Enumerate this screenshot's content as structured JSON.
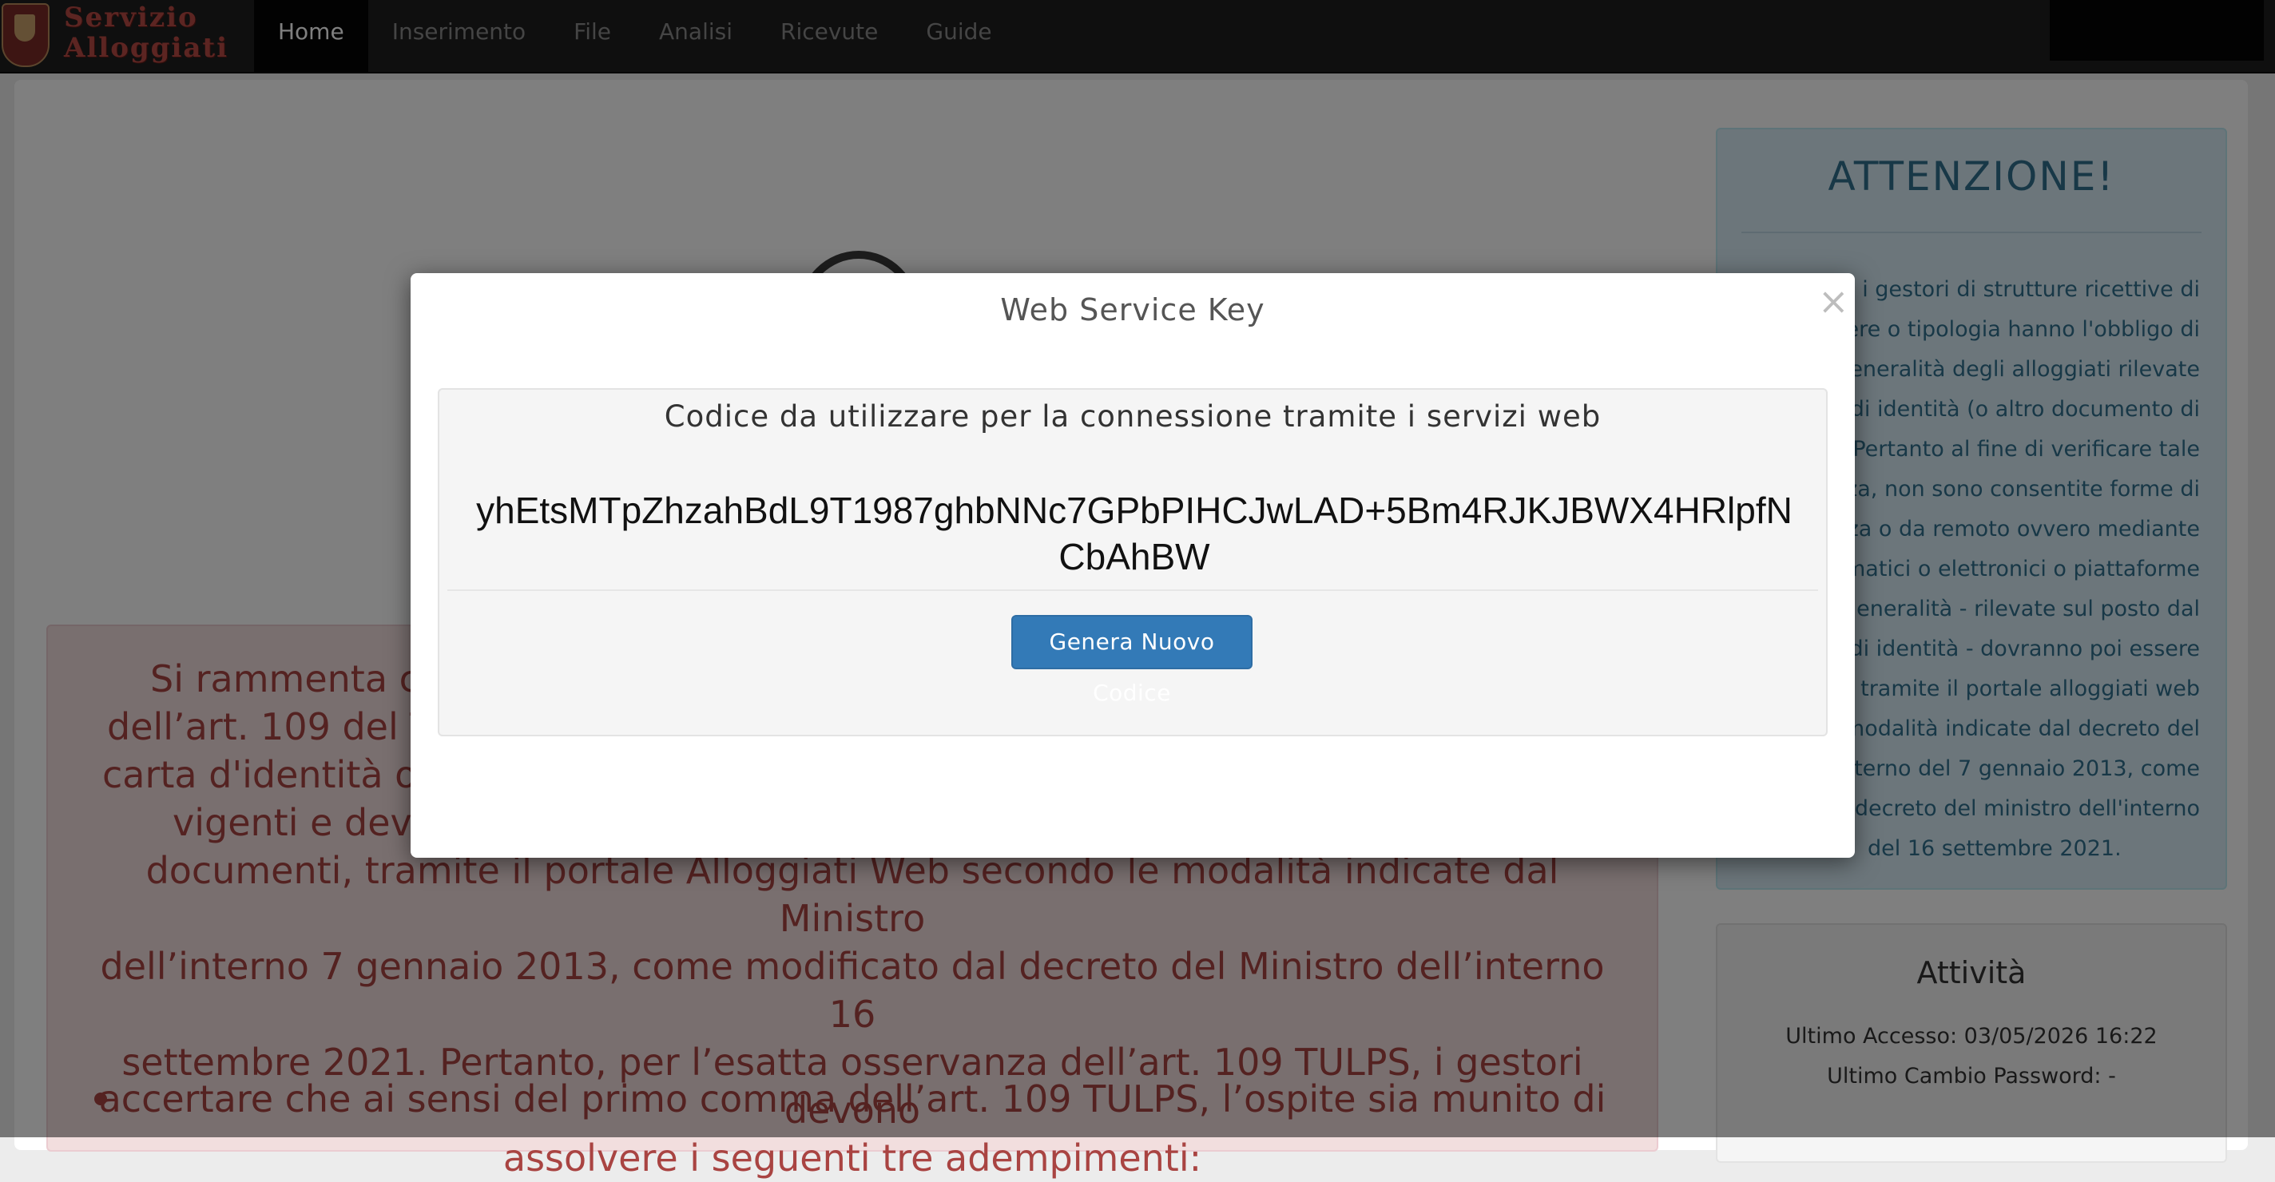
{
  "brand": {
    "line1": "Servizio",
    "line2": "Alloggiati"
  },
  "nav": {
    "items": [
      {
        "label": "Home",
        "active": true
      },
      {
        "label": "Inserimento"
      },
      {
        "label": "File"
      },
      {
        "label": "Analisi"
      },
      {
        "label": "Ricevute"
      },
      {
        "label": "Guide"
      }
    ]
  },
  "notice": {
    "lines": [
      "Si rammenta ch",
      "dell’art. 109 del T",
      "carta d'identità o",
      "vigenti e devo",
      "documenti, tramite il portale Alloggiati Web secondo le modalità indicate dal Ministro",
      "dell’interno 7 gennaio 2013, come modificato dal decreto del Ministro dell’interno 16",
      "settembre 2021. Pertanto, per l’esatta osservanza dell’art. 109 TULPS, i gestori devono",
      "assolvere i seguenti tre adempimenti:"
    ],
    "bullet": "accertare che ai sensi del primo comma dell’art. 109 TULPS, l’ospite sia munito di"
  },
  "attention": {
    "title": "ATTENZIONE!",
    "lines": [
      "e che i gestori di strutture ricettive di",
      "nere o tipologia hanno l'obbligo di",
      "e le generalità degli alloggiati rilevate",
      "ta di identità (o altro documento di",
      "ione). Pertanto al fine di verificare tale",
      "lenza, non sono consentite forme di",
      "stanza o da remoto ovvero mediante",
      "telematici o elettronici o piattaforme",
      "generalità - rilevate sul posto dal",
      "to di identità - dovranno poi essere",
      "ate tramite il portale alloggiati web",
      "e modalità indicate dal decreto del",
      "ell'interno del 7 gennaio 2013, come",
      "dal decreto del ministro dell'interno",
      "del 16 settembre 2021."
    ]
  },
  "activity": {
    "title": "Attività",
    "last_access": "Ultimo Accesso: 03/05/2026 16:22",
    "last_password_change": "Ultimo Cambio Password: -"
  },
  "modal": {
    "title": "Web Service Key",
    "close_symbol": "×",
    "heading": "Codice da utilizzare per la connessione tramite i servizi web",
    "key": "yhEtsMTpZhzahBdL9T1987ghbNNc7GPbPIHCJwLAD+5Bm4RJKJBWX4HRlpfNCbAhBW",
    "generate_button": "Genera Nuovo Codice"
  }
}
